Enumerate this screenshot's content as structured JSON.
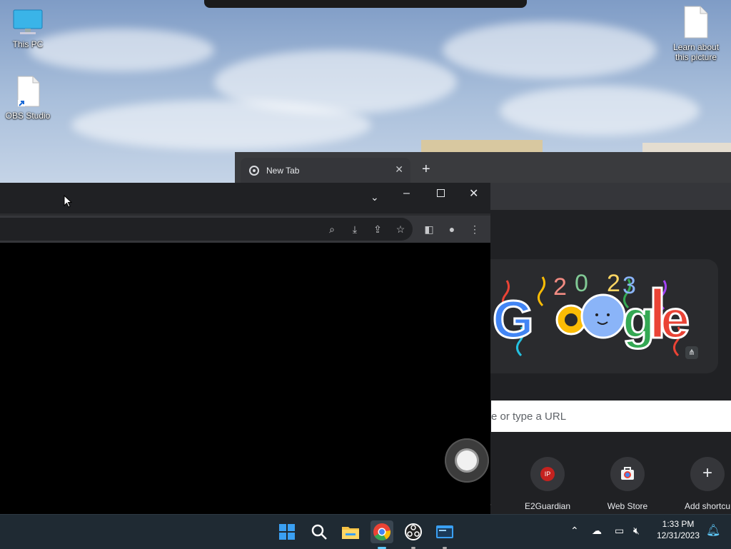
{
  "desktop": {
    "icons": [
      {
        "label": "This PC",
        "icon": "computer-icon"
      },
      {
        "label": "OBS Studio",
        "icon": "file-shortcut-icon"
      },
      {
        "label": "Learn about this picture",
        "icon": "file-icon"
      }
    ]
  },
  "back_window": {
    "tab_title": "New Tab",
    "search_placeholder": "e or type a URL",
    "shortcuts": [
      {
        "label": "E2Guardian",
        "badge": "IP",
        "badge_color": "#c5221f"
      },
      {
        "label": "Web Store",
        "icon": "web-store-icon"
      },
      {
        "label": "Add shortcu",
        "icon": "plus-icon"
      }
    ],
    "doodle_colors": [
      "#4285f4",
      "#ea4335",
      "#fbbc05",
      "#34a853",
      "#a142f4",
      "#24c1e0"
    ]
  },
  "front_window": {
    "toolbar_icons": [
      "search-icon",
      "download-icon",
      "share-icon",
      "star-icon",
      "side-panel-icon",
      "profile-icon",
      "menu-icon"
    ]
  },
  "taskbar": {
    "apps": [
      "start-icon",
      "search-icon",
      "file-explorer-icon",
      "chrome-icon",
      "obs-icon",
      "terminal-icon"
    ],
    "time": "1:33 PM",
    "date": "12/31/2023"
  }
}
